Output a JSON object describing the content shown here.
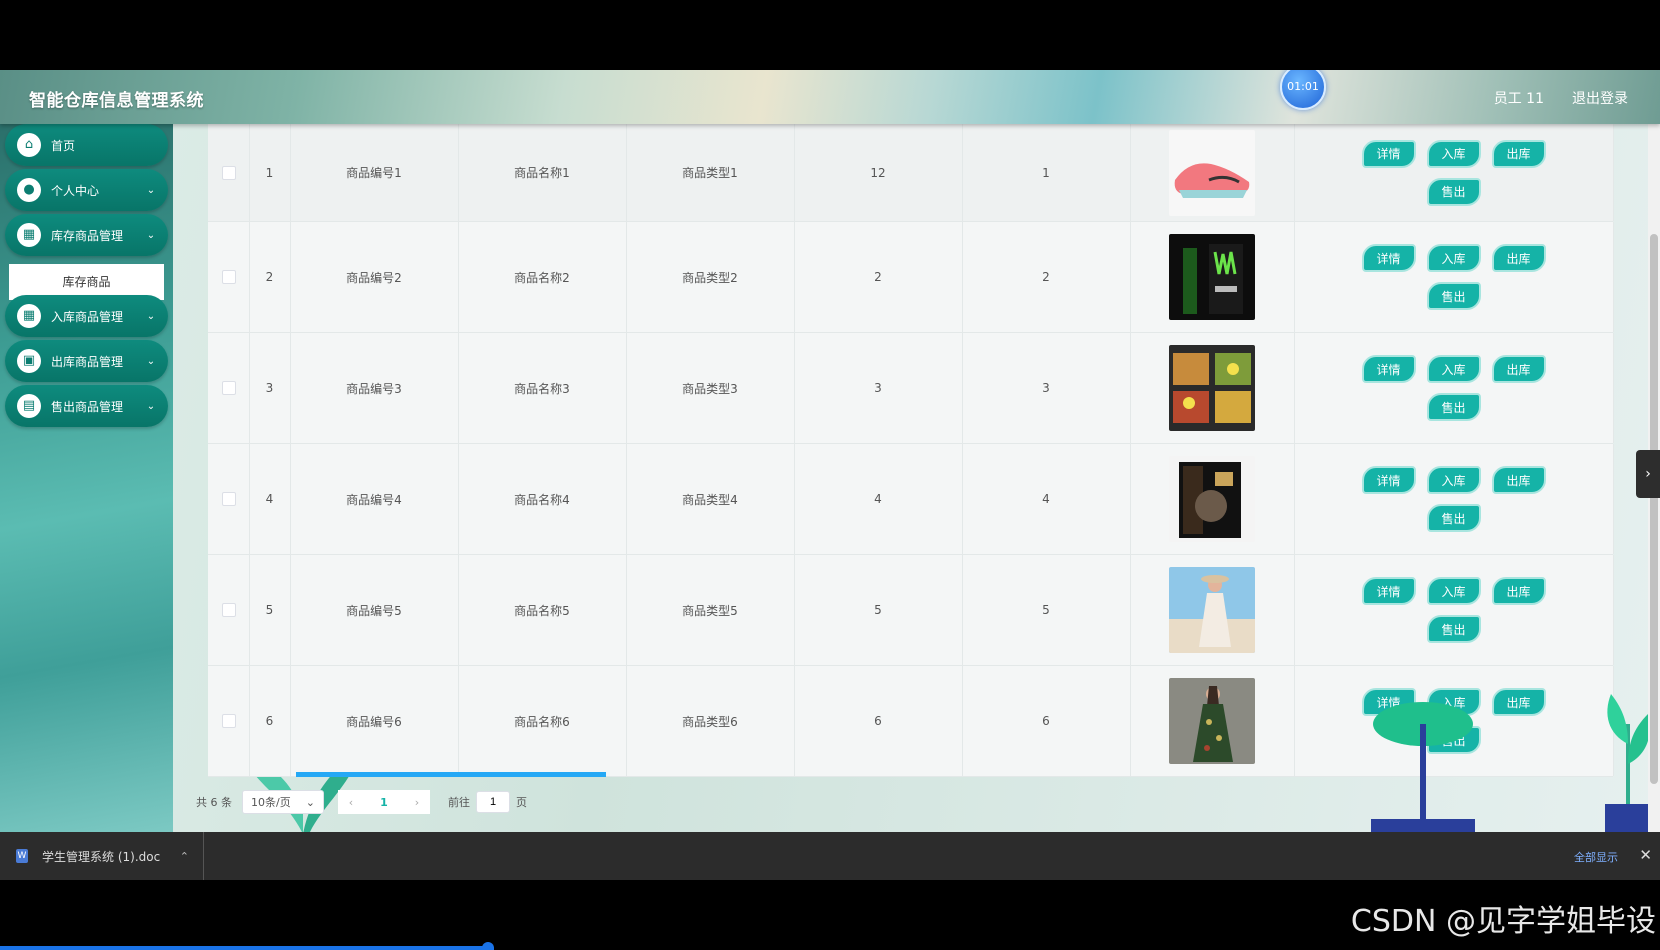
{
  "header": {
    "title": "智能仓库信息管理系统",
    "clock": "01:01",
    "user": "员工 11",
    "logout": "退出登录"
  },
  "sidebar": {
    "items": [
      {
        "label": "首页",
        "icon": "home-icon",
        "expandable": false
      },
      {
        "label": "个人中心",
        "icon": "user-icon",
        "expandable": true
      },
      {
        "label": "库存商品管理",
        "icon": "grid-icon",
        "expandable": true
      },
      {
        "label": "入库商品管理",
        "icon": "grid-icon",
        "expandable": true
      },
      {
        "label": "出库商品管理",
        "icon": "chat-icon",
        "expandable": true
      },
      {
        "label": "售出商品管理",
        "icon": "briefcase-icon",
        "expandable": true
      }
    ],
    "submenu": {
      "label": "库存商品"
    }
  },
  "table": {
    "buttons": {
      "detail": "详情",
      "in": "入库",
      "out": "出库",
      "sell": "售出"
    },
    "rows": [
      {
        "index": "1",
        "code": "商品编号1",
        "name": "商品名称1",
        "type": "商品类型1",
        "qty": "12",
        "val": "1",
        "image": "pink-sneaker"
      },
      {
        "index": "2",
        "code": "商品编号2",
        "name": "商品名称2",
        "type": "商品类型2",
        "qty": "2",
        "val": "2",
        "image": "monster-drink"
      },
      {
        "index": "3",
        "code": "商品编号3",
        "name": "商品名称3",
        "type": "商品类型3",
        "qty": "3",
        "val": "3",
        "image": "food-box"
      },
      {
        "index": "4",
        "code": "商品编号4",
        "name": "商品名称4",
        "type": "商品类型4",
        "qty": "4",
        "val": "4",
        "image": "book-box"
      },
      {
        "index": "5",
        "code": "商品编号5",
        "name": "商品名称5",
        "type": "商品类型5",
        "qty": "5",
        "val": "5",
        "image": "white-dress"
      },
      {
        "index": "6",
        "code": "商品编号6",
        "name": "商品名称6",
        "type": "商品类型6",
        "qty": "6",
        "val": "6",
        "image": "floral-dress"
      }
    ]
  },
  "pagination": {
    "total": "共 6 条",
    "page_size": "10条/页",
    "current": "1",
    "goto_label": "前往",
    "goto_value": "1",
    "goto_suffix": "页"
  },
  "download_bar": {
    "filename": "学生管理系统 (1).doc",
    "show_all": "全部显示"
  },
  "watermark": "CSDN @见字学姐毕设",
  "colors": {
    "accent": "#15b3a7",
    "menu": "#087568"
  }
}
